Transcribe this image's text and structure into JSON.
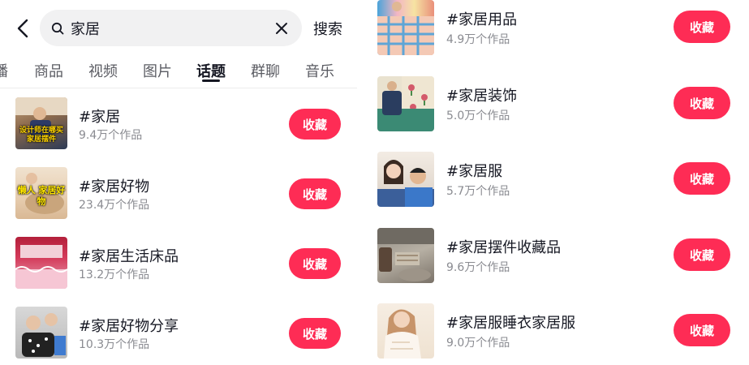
{
  "search": {
    "query": "家居",
    "submit_label": "搜索"
  },
  "tabs": [
    "播",
    "商品",
    "视频",
    "图片",
    "话题",
    "群聊",
    "音乐"
  ],
  "active_tab": "话题",
  "left_topics": [
    {
      "title": "#家居",
      "count": "9.4万个作品",
      "button": "收藏",
      "thumb_caption": "设计师在哪买 家居摆件"
    },
    {
      "title": "#家居好物",
      "count": "23.4万个作品",
      "button": "收藏",
      "thumb_caption": "懒人 家居好物"
    },
    {
      "title": "#家居生活床品",
      "count": "13.2万个作品",
      "button": "收藏",
      "thumb_caption": ""
    },
    {
      "title": "#家居好物分享",
      "count": "10.3万个作品",
      "button": "收藏",
      "thumb_caption": ""
    }
  ],
  "right_topics": [
    {
      "title": "#家居用品",
      "count": "4.9万个作品",
      "button": "收藏"
    },
    {
      "title": "#家居装饰",
      "count": "5.0万个作品",
      "button": "收藏"
    },
    {
      "title": "#家居服",
      "count": "5.7万个作品",
      "button": "收藏"
    },
    {
      "title": "#家居摆件收藏品",
      "count": "9.6万个作品",
      "button": "收藏"
    },
    {
      "title": "#家居服睡衣家居服",
      "count": "9.0万个作品",
      "button": "收藏"
    }
  ],
  "colors": {
    "accent": "#fe2c55",
    "text": "#161823",
    "muted": "#8a8b91",
    "search_bg": "#f1f1f2"
  },
  "icons": {
    "back": "chevron-left-icon",
    "search": "search-icon",
    "clear": "close-icon"
  }
}
